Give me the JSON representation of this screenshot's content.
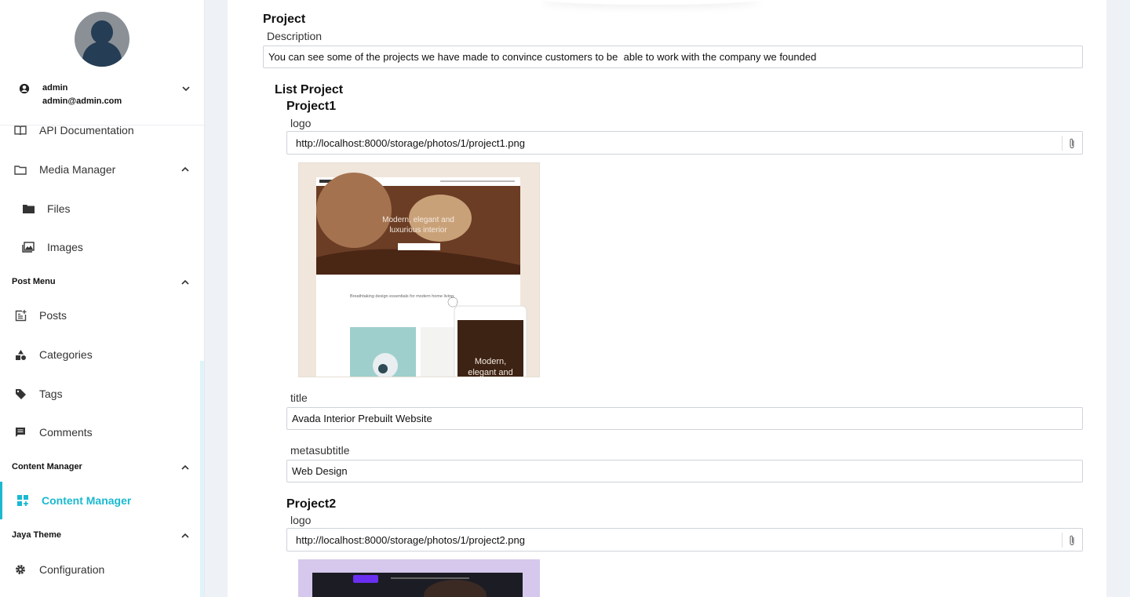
{
  "sidebar": {
    "user": {
      "name": "admin",
      "email": "admin@admin.com"
    },
    "items": {
      "api_docs": "API Documentation",
      "media_manager": "Media Manager",
      "files": "Files",
      "images": "Images",
      "post_menu": "Post Menu",
      "posts": "Posts",
      "categories": "Categories",
      "tags": "Tags",
      "comments": "Comments",
      "content_manager_section": "Content Manager",
      "content_manager": "Content Manager",
      "jaya_theme": "Jaya Theme",
      "configuration": "Configuration"
    },
    "accent": "#1ab9d0"
  },
  "form": {
    "project_label": "Project",
    "description_label": "Description",
    "description_value": "You can see some of the projects we have made to convince customers to be  able to work with the company we founded",
    "list_project_label": "List Project",
    "projects": [
      {
        "heading": "Project1",
        "logo_label": "logo",
        "logo_value": "http://localhost:8000/storage/photos/1/project1.png",
        "title_label": "title",
        "title_value": "Avada Interior Prebuilt Website",
        "metasubtitle_label": "metasubtitle",
        "metasubtitle_value": "Web Design",
        "preview": {
          "hero_line1": "Modern, elegant and",
          "hero_line2": "luxurious interior",
          "tagline": "Breathtaking design essentials for modern home living.",
          "mobile_text1": "Modern,",
          "mobile_text2": "elegant and"
        }
      },
      {
        "heading": "Project2",
        "logo_label": "logo",
        "logo_value": "http://localhost:8000/storage/photos/1/project2.png"
      }
    ]
  }
}
